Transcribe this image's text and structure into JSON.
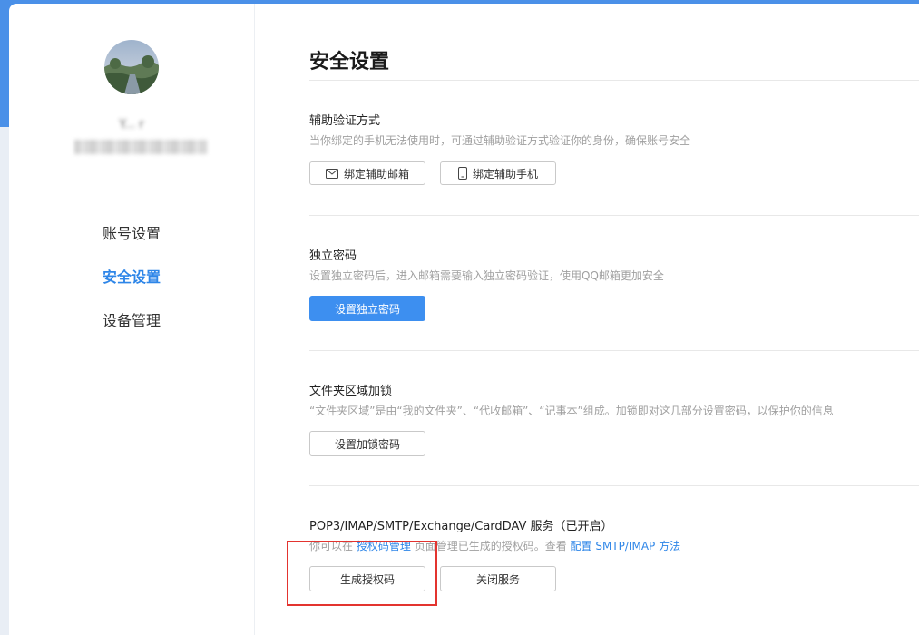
{
  "sidebar": {
    "user_name": "Y... r",
    "user_email": "",
    "items": [
      {
        "label": "账号设置",
        "active": false
      },
      {
        "label": "安全设置",
        "active": true
      },
      {
        "label": "设备管理",
        "active": false
      }
    ]
  },
  "main": {
    "title": "安全设置",
    "sections": {
      "aux_verify": {
        "title": "辅助验证方式",
        "desc": "当你绑定的手机无法使用时，可通过辅助验证方式验证你的身份，确保账号安全",
        "buttons": [
          {
            "label": "绑定辅助邮箱",
            "icon": "mail-icon"
          },
          {
            "label": "绑定辅助手机",
            "icon": "phone-icon"
          }
        ]
      },
      "independent_pwd": {
        "title": "独立密码",
        "desc": "设置独立密码后，进入邮箱需要输入独立密码验证，使用QQ邮箱更加安全",
        "button": "设置独立密码"
      },
      "folder_lock": {
        "title": "文件夹区域加锁",
        "desc": "“文件夹区域”是由“我的文件夹”、“代收邮箱”、“记事本”组成。加锁即对这几部分设置密码，以保护你的信息",
        "button": "设置加锁密码"
      },
      "pop3": {
        "title": "POP3/IMAP/SMTP/Exchange/CardDAV 服务（已开启）",
        "desc_prefix": "你可以在",
        "desc_link1": "授权码管理",
        "desc_middle": "页面管理已生成的授权码。查看",
        "desc_link2": "配置 SMTP/IMAP 方法",
        "buttons": [
          {
            "label": "生成授权码"
          },
          {
            "label": "关闭服务"
          }
        ]
      }
    }
  },
  "colors": {
    "accent": "#2e86e8",
    "primary_button": "#3d8ff0",
    "header_band": "#4a90e8",
    "highlight": "#e3342f"
  }
}
